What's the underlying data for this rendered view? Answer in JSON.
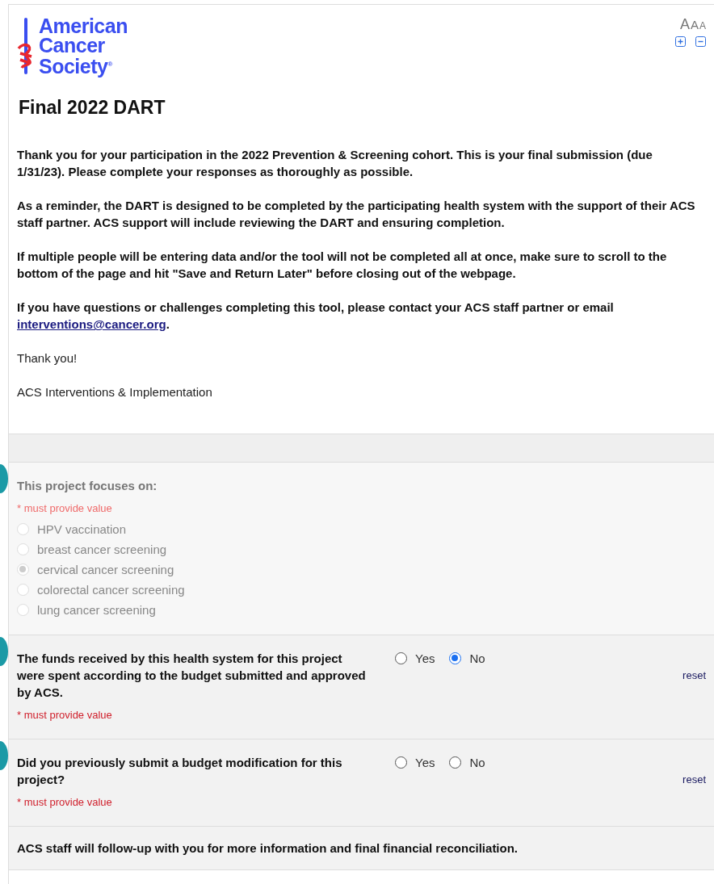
{
  "logo": {
    "lines": [
      "American",
      "Cancer",
      "Society$^{®}$"
    ]
  },
  "font_size_controls": {
    "letters": [
      "A",
      "A",
      "A"
    ]
  },
  "title": "Final 2022 DART",
  "intro": [
    {
      "text": "Thank you for your participation in the 2022 Prevention & Screening cohort. This is your final submission (due 1/31/23). Please complete your responses as thoroughly as possible.",
      "bold": true
    },
    {
      "text": "As a reminder, the DART is designed to be completed by the participating health system with the support of their ACS staff partner. ACS support will include reviewing the DART and ensuring completion.",
      "bold": true
    },
    {
      "text": "If multiple people will be entering data and/or the tool will not be completed all at once, make sure to scroll to the bottom of the page and hit \"Save and Return Later\" before closing out of the webpage.",
      "bold": true
    },
    {
      "text": "If you have questions or challenges completing this tool, please contact your ACS staff partner or email ",
      "link": "interventions@cancer.org",
      "after": ".",
      "bold": true
    },
    {
      "text": "Thank you!",
      "bold": false
    },
    {
      "text": "ACS Interventions & Implementation",
      "bold": false
    }
  ],
  "questions": [
    {
      "kind": "vertical",
      "label": "This project focuses on:",
      "required_note": "* must provide value",
      "disabled": true,
      "options": [
        {
          "label": "HPV vaccination",
          "selected": false
        },
        {
          "label": "breast cancer screening",
          "selected": false
        },
        {
          "label": "cervical cancer screening",
          "selected": true
        },
        {
          "label": "colorectal cancer screening",
          "selected": false
        },
        {
          "label": "lung cancer screening",
          "selected": false
        }
      ]
    },
    {
      "kind": "horizontal",
      "label": "The funds received by this health system for this project were spent according to the budget submitted and approved by ACS.",
      "required_note": "* must provide value",
      "disabled": false,
      "reset": "reset",
      "options": [
        {
          "label": "Yes",
          "selected": false
        },
        {
          "label": "No",
          "selected": true
        }
      ]
    },
    {
      "kind": "horizontal",
      "label": "Did you previously submit a budget modification for this project?",
      "required_note": "* must provide value",
      "disabled": false,
      "reset": "reset",
      "options": [
        {
          "label": "Yes",
          "selected": false
        },
        {
          "label": "No",
          "selected": false
        }
      ]
    }
  ],
  "footer_note": "ACS staff will follow-up with you for more information and final financial reconciliation."
}
